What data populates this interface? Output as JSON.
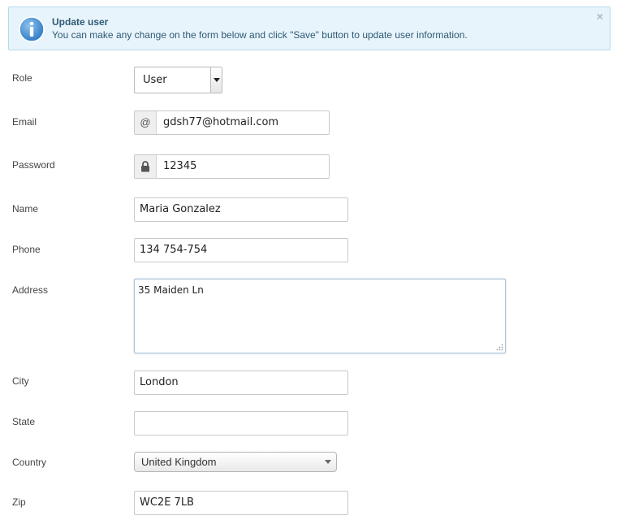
{
  "alert": {
    "icon": "info-icon",
    "title": "Update user",
    "message": "You can make any change on the form below and click \"Save\" button to update user information.",
    "close": "×",
    "accent": "#2d5a75"
  },
  "form": {
    "role": {
      "label": "Role",
      "value": "User"
    },
    "email": {
      "label": "Email",
      "addon": "@",
      "value": "gdsh77@hotmail.com"
    },
    "password": {
      "label": "Password",
      "addon_icon": "lock-icon",
      "value": "12345"
    },
    "name": {
      "label": "Name",
      "value": "Maria Gonzalez"
    },
    "phone": {
      "label": "Phone",
      "value": "134 754-754"
    },
    "address": {
      "label": "Address",
      "value": "35 Maiden Ln"
    },
    "city": {
      "label": "City",
      "value": "London"
    },
    "state": {
      "label": "State",
      "value": ""
    },
    "country": {
      "label": "Country",
      "value": "United Kingdom"
    },
    "zip": {
      "label": "Zip",
      "value": "WC2E 7LB"
    }
  }
}
